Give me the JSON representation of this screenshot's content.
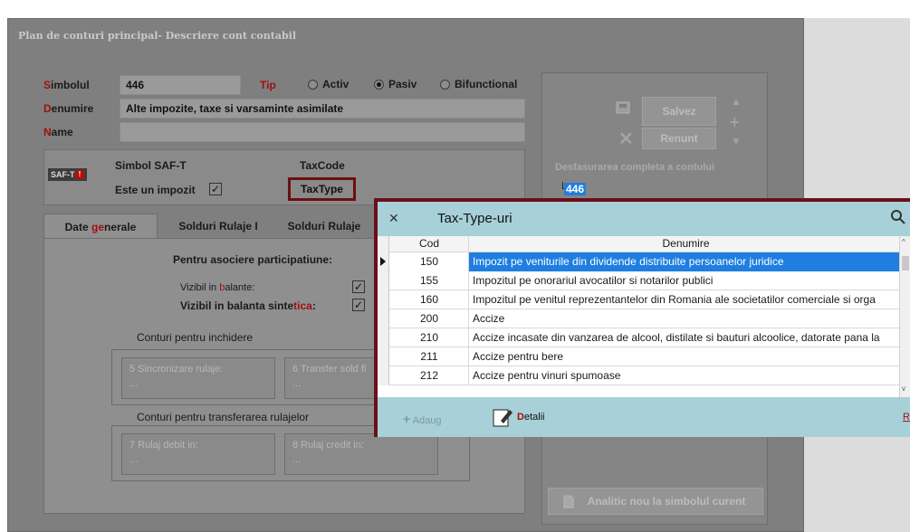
{
  "window": {
    "title": "Plan de conturi principal- Descriere cont contabil"
  },
  "form": {
    "simbolul_label_initial": "S",
    "simbolul_label_rest": "imbolul",
    "simbolul_value": "446",
    "tip_label": "Tip",
    "radio_activ": "Activ",
    "radio_pasiv": "Pasiv",
    "radio_bifunctional": "Bifunctional",
    "selected_type": "Pasiv",
    "denumire_label_initial": "D",
    "denumire_label_rest": "enumire",
    "denumire_value": "Alte impozite, taxe si varsaminte asimilate",
    "name_label_initial": "N",
    "name_label_rest": "ame",
    "name_value": ""
  },
  "saft": {
    "badge": "SAF-T",
    "badge_mark": "!",
    "simbol_label": "Simbol SAF-T",
    "taxcode_label": "TaxCode",
    "impozit_label": "Este un impozit",
    "impozit_checked": "✓",
    "taxtype_label": "TaxType"
  },
  "tabs": {
    "date_generale_pre": "Date ",
    "date_generale_red": "ge",
    "date_generale_post": "nerale",
    "solduri_rulaje_1": "Solduri Rulaje I",
    "solduri_rulaje_2": "Solduri Rulaje"
  },
  "general": {
    "asociere_label": "Pentru asociere participatiune:",
    "vizibil_balante_pre": "Vizibil in ",
    "vizibil_balante_red": "b",
    "vizibil_balante_post": "alante:",
    "vizibil_balante_checked": "✓",
    "vizibil_sintetica_pre": "Vizibil in balanta sinte",
    "vizibil_sintetica_red": "tica",
    "vizibil_sintetica_post": ":",
    "vizibil_sintetica_checked": "✓",
    "conturi_inchidere": "Conturi pentru inchidere",
    "sincronizare_label": "5 Sincronizare rulaje:",
    "sincronizare_value": "...",
    "transfer_label": "6 Transfer sold fi",
    "transfer_value": "...",
    "conturi_transfer": "Conturi pentru transferarea rulajelor",
    "rulaj_debit_label": "7 Rulaj debit in:",
    "rulaj_debit_value": "...",
    "rulaj_credit_label": "8 Rulaj credit in:",
    "rulaj_credit_value": "..."
  },
  "side": {
    "salvez": "Salvez",
    "renunt": "Renunt",
    "desfasurare": "Desfasurarea completa a contului",
    "tree_value": "446",
    "analitic": "Analitic nou la simbolul curent"
  },
  "dialog": {
    "title": "Tax-Type-uri",
    "col_cod": "Cod",
    "col_denumire": "Denumire",
    "rows": [
      {
        "cod": "150",
        "den": "Impozit pe veniturile din dividende distribuite persoanelor juridice"
      },
      {
        "cod": "155",
        "den": "Impozitul pe onorariul avocatilor si notarilor publici"
      },
      {
        "cod": "160",
        "den": "Impozitul pe venitul reprezentantelor din Romania ale societatilor comerciale si orga"
      },
      {
        "cod": "200",
        "den": "Accize"
      },
      {
        "cod": "210",
        "den": "Accize incasate din vanzarea de alcool, distilate si bauturi alcoolice, datorate pana la"
      },
      {
        "cod": "211",
        "den": "Accize pentru bere"
      },
      {
        "cod": "212",
        "den": "Accize pentru vinuri spumoase"
      }
    ],
    "adaug": "Adaug",
    "detalii_d": "D",
    "detalii_rest": "etalii",
    "right_link": "R"
  },
  "colors": {
    "accent_red": "#a01010",
    "dialog_border": "#6b0f1a",
    "dialog_header": "#a7d0d8",
    "selection": "#1f7ee0"
  }
}
